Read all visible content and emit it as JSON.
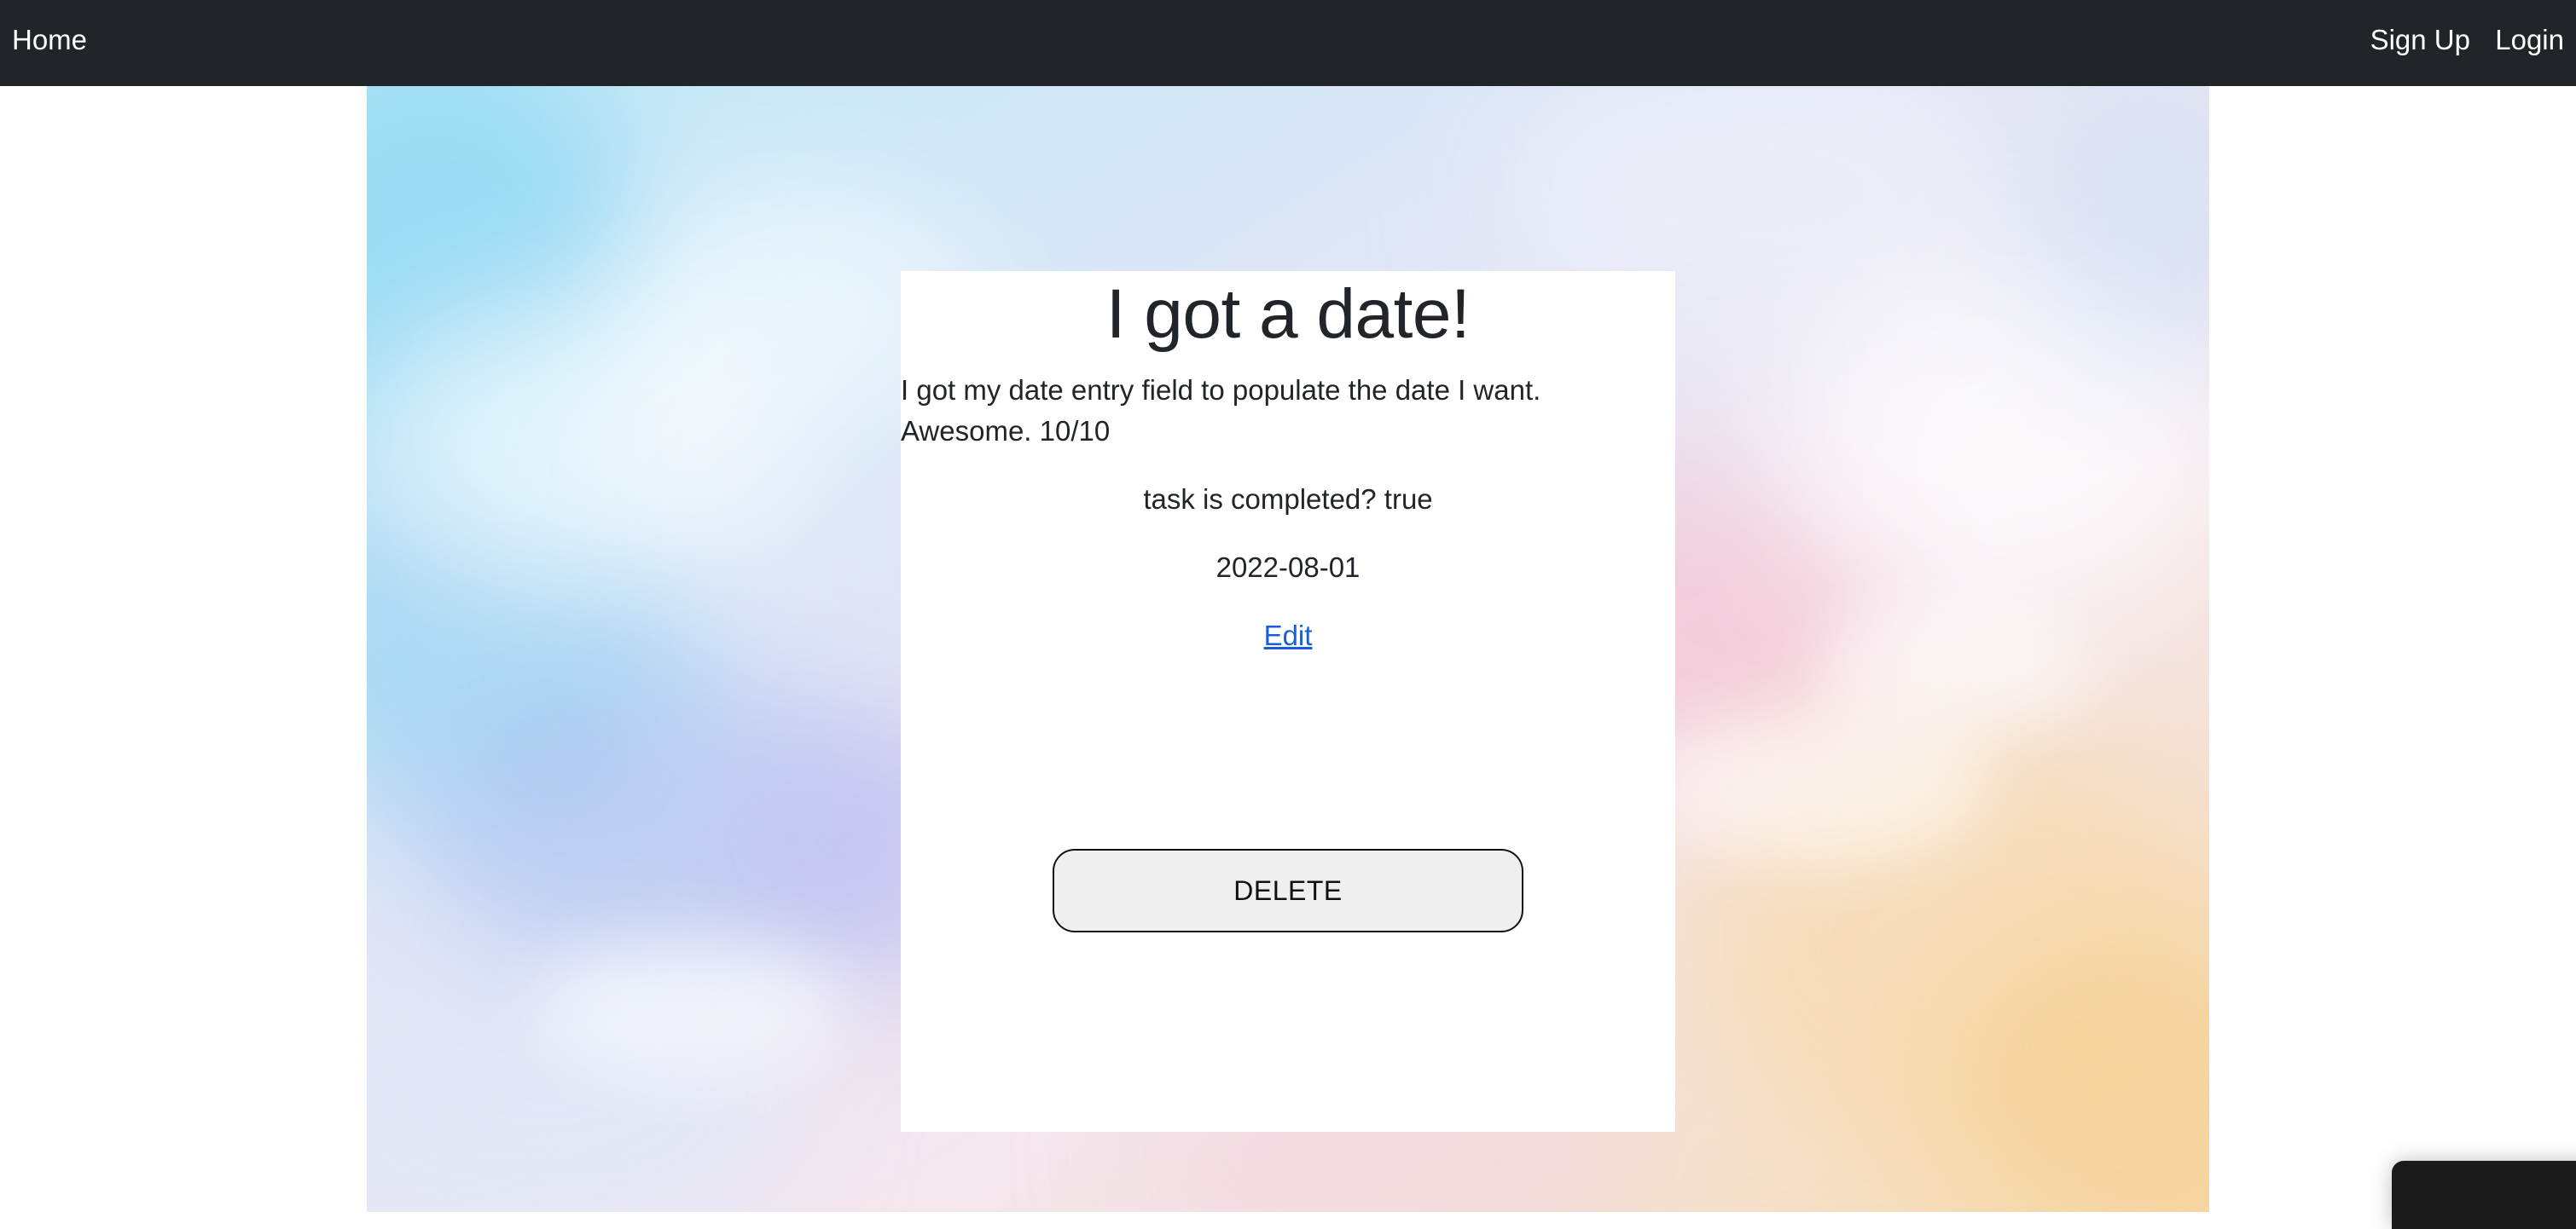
{
  "nav": {
    "home_label": "Home",
    "signup_label": "Sign Up",
    "login_label": "Login"
  },
  "task": {
    "title": "I got a date!",
    "description": "I got my date entry field to populate the date I want. Awesome. 10/10",
    "status_text": "task is completed? true",
    "date": "2022-08-01",
    "edit_label": "Edit",
    "delete_label": "DELETE"
  },
  "colors": {
    "navbar_bg": "#212529",
    "link": "#1a5fd6",
    "button_bg": "#efefef"
  }
}
